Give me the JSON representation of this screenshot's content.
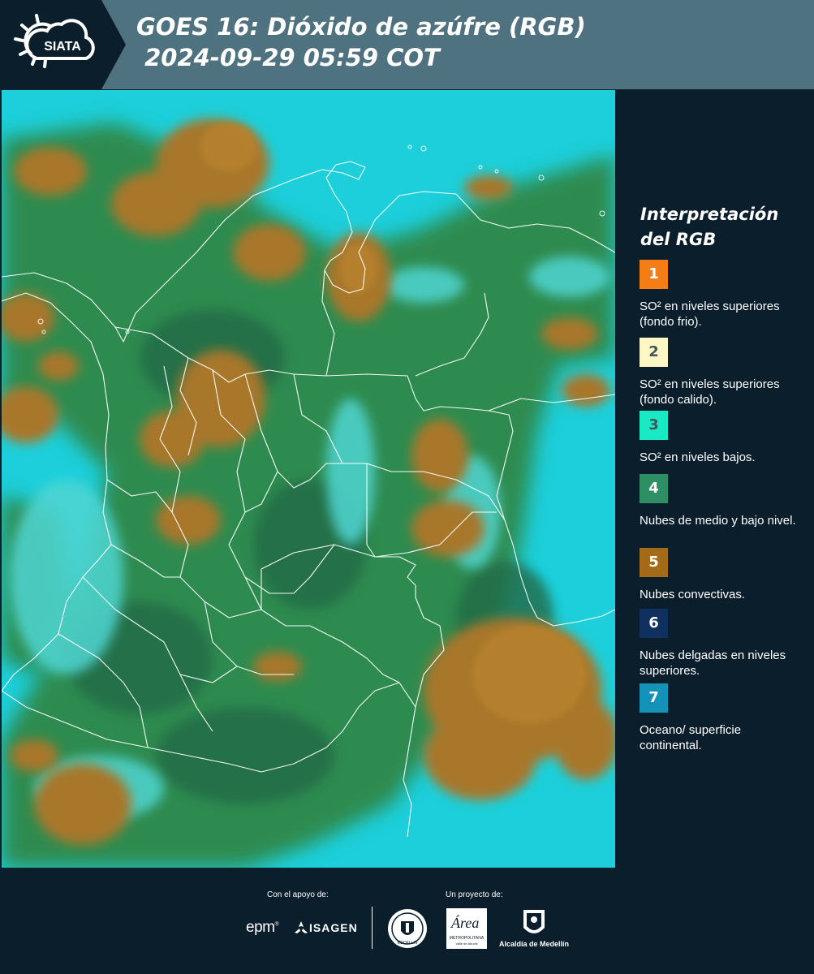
{
  "header": {
    "logo_text": "SIATA",
    "title": "GOES 16: Dióxido de azúfre (RGB)\n 2024-09-29 05:59 COT"
  },
  "legend": {
    "title": "Interpretación del RGB",
    "items": [
      {
        "number": "1",
        "color": "#f47d17",
        "text_color": "#ffffff",
        "label": "SO² en niveles superiores (fondo frio)."
      },
      {
        "number": "2",
        "color": "#fdf6c5",
        "text_color": "#4a5259",
        "label": "SO² en niveles superiores (fondo calido)."
      },
      {
        "number": "3",
        "color": "#19e9c5",
        "text_color": "#4a5259",
        "label": "SO² en niveles bajos."
      },
      {
        "number": "4",
        "color": "#2f8f64",
        "text_color": "#ffffff",
        "label": "Nubes de medio y bajo nivel."
      },
      {
        "number": "5",
        "color": "#a36a18",
        "text_color": "#ffffff",
        "label": "Nubes convectivas."
      },
      {
        "number": "6",
        "color": "#10305f",
        "text_color": "#ffffff",
        "label": "Nubes delgadas en niveles superiores."
      },
      {
        "number": "7",
        "color": "#1592b8",
        "text_color": "#ffffff",
        "label": "Oceano/ superficie continental."
      }
    ]
  },
  "footer": {
    "support_label": "Con el apoyo de:",
    "project_label": "Un proyecto de:",
    "epm_logo_text": "epm",
    "isagen_logo_text": "ISAGEN",
    "medellin_seal_text": "MEDELLIN",
    "area_logo_text": "Área",
    "area_logo_subtext": "METROPOLITANA",
    "area_logo_subtext2": "Valle de Aburrá",
    "alcaldia_label": "Alcaldía de Medellín"
  },
  "colors": {
    "header_bg": "#4f7280",
    "panel_bg": "#0b1e2c",
    "ocean": "#1ed3dd",
    "vegetation": "#2c8a52",
    "convective_cloud": "#a7782a"
  }
}
